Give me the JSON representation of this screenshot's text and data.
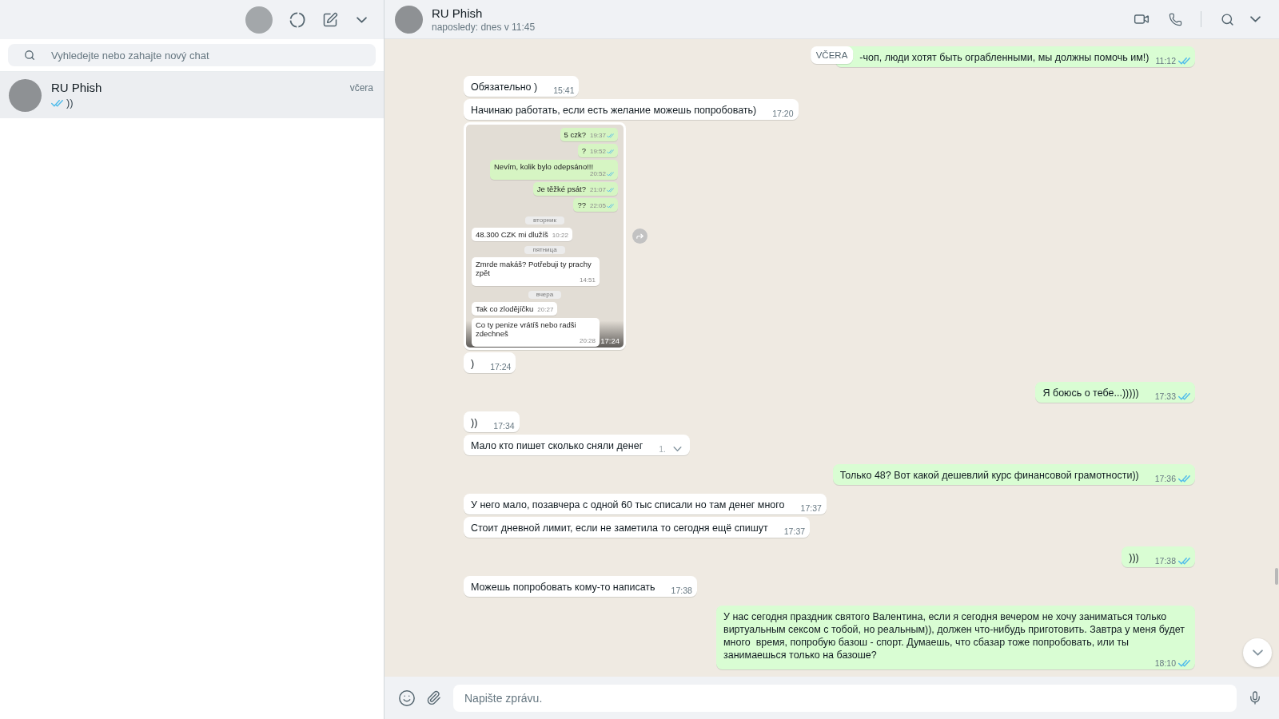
{
  "sidebar": {
    "search": {
      "placeholder": "Vyhledejte nebo zahajte nový chat"
    },
    "chats": [
      {
        "name": "RU Phish",
        "time": "včera",
        "preview": "))",
        "read": true,
        "selected": true
      }
    ]
  },
  "chat": {
    "header": {
      "name": "RU Phish",
      "status": "naposledy: dnes v 11:45"
    },
    "sticky_date": "VČERA",
    "messages": [
      {
        "kind": "text",
        "outgoing": true,
        "text": "-чоп, люди хотят быть ограбленными, мы должны помочь им!)",
        "time": "11:12",
        "read": true,
        "hovered": false
      },
      {
        "kind": "text",
        "outgoing": false,
        "text": "Обязательно )",
        "time": "15:41",
        "hovered": false
      },
      {
        "kind": "text",
        "outgoing": false,
        "text": "Начинаю работать, если есть желание можешь попробовать)",
        "time": "17:20",
        "hovered": false
      },
      {
        "kind": "image",
        "outgoing": false,
        "time": "17:24",
        "hovered": false,
        "screenshot": [
          {
            "kind": "bubble",
            "outgoing": true,
            "text": "5 czk?",
            "time": "19:37",
            "read": true
          },
          {
            "kind": "bubble",
            "outgoing": true,
            "text": "?",
            "time": "19:52",
            "read": true
          },
          {
            "kind": "bubble",
            "outgoing": true,
            "text": "Nevím, kolik bylo odepsáno!!!",
            "time": "20:52",
            "read": true
          },
          {
            "kind": "bubble",
            "outgoing": true,
            "text": "Je těžké psát?",
            "time": "21:07",
            "read": true
          },
          {
            "kind": "bubble",
            "outgoing": true,
            "text": "??",
            "time": "22:05",
            "read": true
          },
          {
            "kind": "date",
            "text": "вторник"
          },
          {
            "kind": "bubble",
            "outgoing": false,
            "text": "48.300 CZK mi dlužíš",
            "time": "10:22"
          },
          {
            "kind": "date",
            "text": "пятница"
          },
          {
            "kind": "bubble",
            "outgoing": false,
            "text": "Zmrde makáš? Potřebuji ty prachy zpět",
            "time": "14:51"
          },
          {
            "kind": "date",
            "text": "вчера"
          },
          {
            "kind": "bubble",
            "outgoing": false,
            "text": "Tak co zlodějíčku",
            "time": "20:27"
          },
          {
            "kind": "bubble",
            "outgoing": false,
            "text": "Co ty penize vrátíš nebo radši zdechneš",
            "time": "20:28"
          }
        ]
      },
      {
        "kind": "text",
        "outgoing": false,
        "text": ")",
        "time": "17:24",
        "hovered": false
      },
      {
        "kind": "text",
        "outgoing": true,
        "text": "Я боюсь о тебе...)))))",
        "time": "17:33",
        "read": true,
        "hovered": false
      },
      {
        "kind": "text",
        "outgoing": false,
        "text": "))",
        "time": "17:34",
        "hovered": false
      },
      {
        "kind": "text",
        "outgoing": false,
        "text": "Мало кто пишет сколько сняли денег",
        "time": "1.",
        "hovered": true
      },
      {
        "kind": "text",
        "outgoing": true,
        "text": "Только 48? Вот какой дешевлий курс финансовой грамотности))",
        "time": "17:36",
        "read": true,
        "hovered": false
      },
      {
        "kind": "text",
        "outgoing": false,
        "text": "У него мало, позавчера с одной 60 тыс списали но там денег много",
        "time": "17:37",
        "hovered": false
      },
      {
        "kind": "text",
        "outgoing": false,
        "text": "Стоит дневной лимит, если не заметила то сегодня ещё спишут",
        "time": "17:37",
        "hovered": false
      },
      {
        "kind": "text",
        "outgoing": true,
        "text": ")))",
        "time": "17:38",
        "read": true,
        "hovered": false
      },
      {
        "kind": "text",
        "outgoing": false,
        "text": "Можешь попробовать кому-то написать",
        "time": "17:38",
        "hovered": false
      },
      {
        "kind": "text",
        "outgoing": true,
        "text": "У нас сегодня праздник святого Валентина, если я сегодня вечером не хочу заниматься только виртуальным сексом с тобой, но реальным)), должен что-нибудь приготовить. Завтра у меня будет много  время, попробую базош - спорт. Думаешь, что сбазар тоже попробовать, или ты занимаешься только на базоше?",
        "time": "18:10",
        "read": true,
        "hovered": false
      }
    ],
    "composer": {
      "placeholder": "Napište zprávu."
    }
  }
}
